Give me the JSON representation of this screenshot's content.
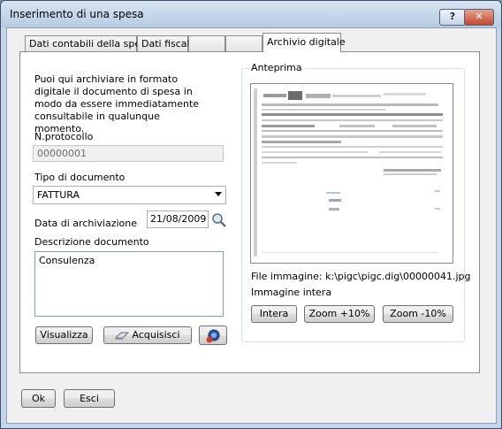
{
  "window": {
    "title": "Inserimento di una spesa"
  },
  "titlebar": {
    "help_label": "?",
    "close_label": "✕"
  },
  "tabs": [
    {
      "label": "Dati contabili della spesa"
    },
    {
      "label": "Dati fiscali"
    },
    {
      "label": ""
    },
    {
      "label": ""
    },
    {
      "label": "Archivio digitale",
      "active": true
    }
  ],
  "archive": {
    "description": "Puoi qui archiviare in formato digitale il documento di spesa in modo da essere immediatamente consultabile in qualunque momento.",
    "protocol_label": "N.protocollo",
    "protocol_value": "00000001",
    "doctype_label": "Tipo di documento",
    "doctype_value": "FATTURA",
    "date_label": "Data di archiviazione",
    "date_value": "21/08/2009",
    "desc_label": "Descrizione documento",
    "desc_value": "Consulenza",
    "view_button": "Visualizza",
    "acquire_button": "Acquisisci"
  },
  "preview": {
    "group_title": "Anteprima",
    "file_label": "File immagine: k:\\pigc\\pigc.dig\\00000041.jpg",
    "mode_label": "Immagine intera",
    "full_button": "Intera",
    "zoom_in_button": "Zoom +10%",
    "zoom_out_button": "Zoom -10%"
  },
  "footer": {
    "ok_button": "Ok",
    "exit_button": "Esci"
  }
}
